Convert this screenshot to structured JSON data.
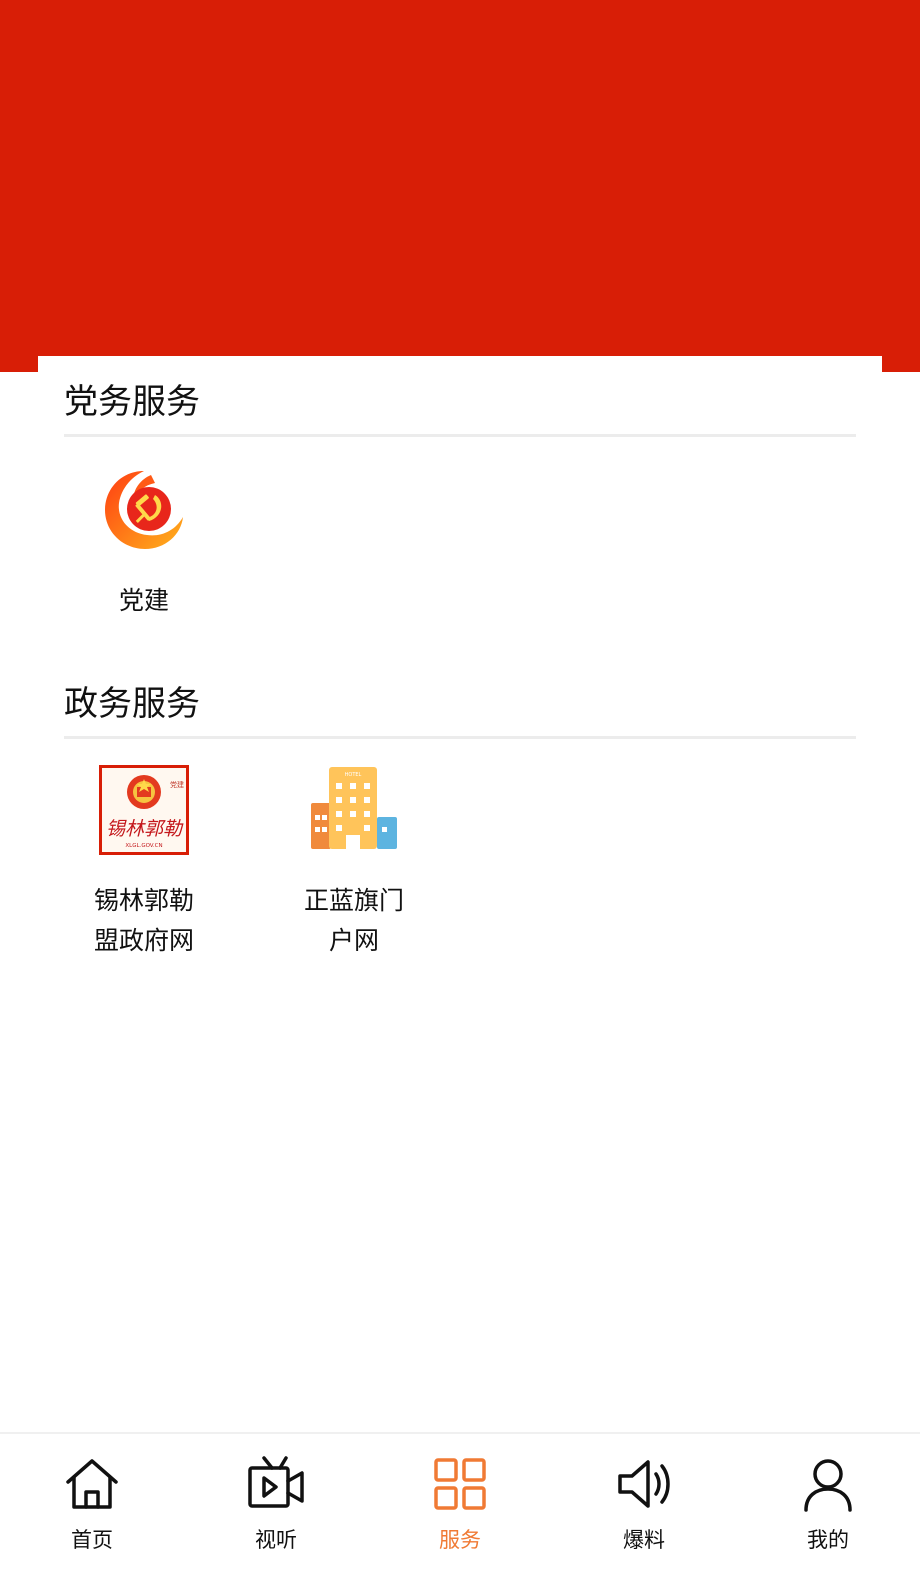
{
  "sections": [
    {
      "title": "党务服务",
      "items": [
        {
          "label": "党建"
        }
      ]
    },
    {
      "title": "政务服务",
      "items": [
        {
          "label": "锡林郭勒盟政府网"
        },
        {
          "label": "正蓝旗门户网"
        }
      ]
    }
  ],
  "icons": {
    "gov_seal_text": "锡林郭勒",
    "gov_seal_sub": "XLGL.GOV.CN",
    "hotel_sign": "HOTEL"
  },
  "tabbar": {
    "items": [
      {
        "label": "首页",
        "icon": "home-icon"
      },
      {
        "label": "视听",
        "icon": "tv-icon"
      },
      {
        "label": "服务",
        "icon": "grid-icon"
      },
      {
        "label": "爆料",
        "icon": "speaker-icon"
      },
      {
        "label": "我的",
        "icon": "user-icon"
      }
    ],
    "active_index": 2
  },
  "colors": {
    "header_red": "#d81e06",
    "active": "#f07a34",
    "text": "#111111",
    "divider": "#ececec"
  }
}
